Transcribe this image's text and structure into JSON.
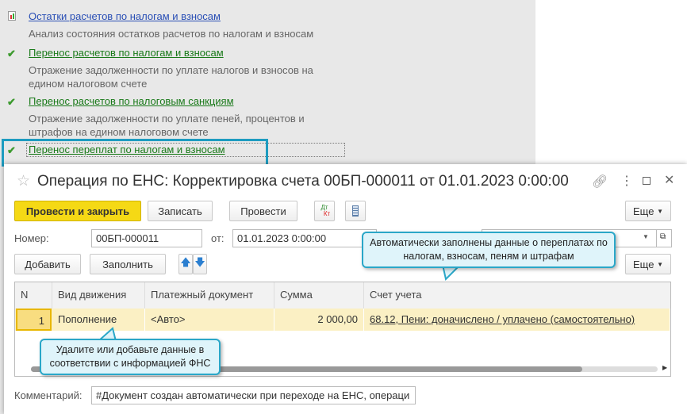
{
  "background_panel": {
    "items": [
      {
        "icon": "report-icon",
        "title": "Остатки расчетов по налогам и взносам",
        "description": "Анализ состояния остатков расчетов по налогам и взносам"
      },
      {
        "icon": "check-icon",
        "title": "Перенос расчетов по налогам и взносам",
        "description": "Отражение задолженности по уплате налогов и взносов на едином налоговом счете"
      },
      {
        "icon": "check-icon",
        "title": "Перенос расчетов по налоговым санкциям",
        "description": "Отражение задолженности по уплате пеней, процентов и штрафов на едином налоговом счете"
      },
      {
        "icon": "check-icon",
        "title": "Перенос переплат по налогам и взносам",
        "description": ""
      }
    ]
  },
  "dialog": {
    "title": "Операция по ЕНС: Корректировка счета 00БП-000011 от 01.01.2023 0:00:00",
    "toolbar": {
      "post_close": "Провести и закрыть",
      "save": "Записать",
      "post": "Провести",
      "dt": "Дт",
      "kt": "Кт",
      "more": "Еще"
    },
    "number_label": "Номер:",
    "number_value": "00БП-000011",
    "date_label": "от:",
    "date_value": "01.01.2023  0:00:00",
    "table_toolbar": {
      "add": "Добавить",
      "fill": "Заполнить",
      "more": "Еще"
    },
    "table": {
      "columns": [
        "N",
        "Вид движения",
        "Платежный документ",
        "Сумма",
        "Счет учета"
      ],
      "rows": [
        {
          "n": "1",
          "type": "Пополнение",
          "doc": "<Авто>",
          "sum": "2 000,00",
          "account": "68.12, Пени: доначислено / уплачено (самостоятельно)"
        }
      ]
    },
    "comment_label": "Комментарий:",
    "comment_value": "#Документ создан автоматически при переходе на ЕНС, операци"
  },
  "callouts": {
    "top": "Автоматически заполнены данные о переплатах по налогам, взносам, пеням и штрафам",
    "bottom": "Удалите или добавьте данные в соответствии с информацией ФНС"
  },
  "colors": {
    "accent": "#1e9cc0",
    "primary_button": "#f5d915",
    "selected_row": "#fbf0c4",
    "link_green": "#1a7a1a"
  }
}
